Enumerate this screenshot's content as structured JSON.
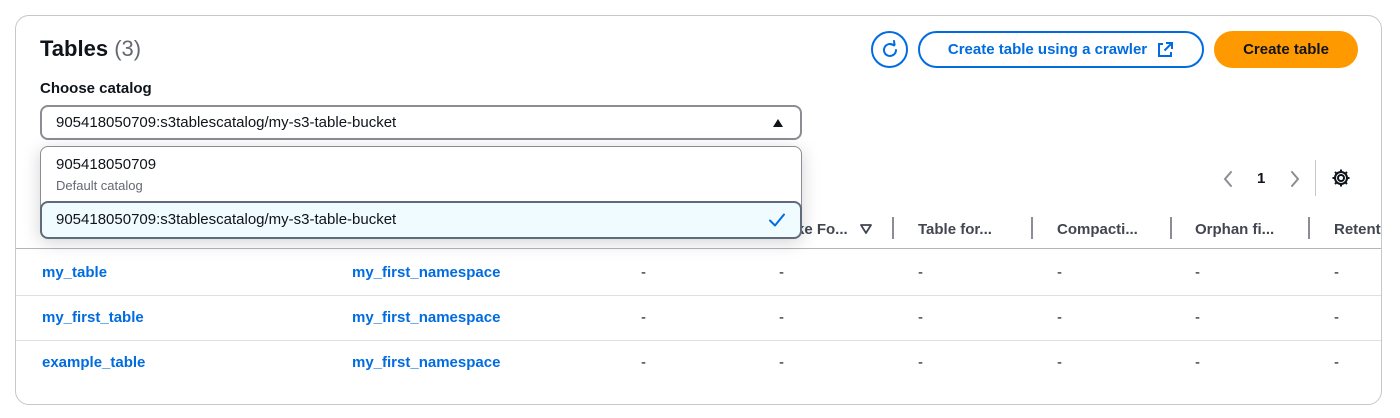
{
  "header": {
    "title": "Tables",
    "count": "(3)",
    "crawler_button_label": "Create table using a crawler",
    "create_button_label": "Create table"
  },
  "catalog": {
    "label": "Choose catalog",
    "selected": "905418050709:s3tablescatalog/my-s3-table-bucket",
    "options": [
      {
        "label": "905418050709",
        "description": "Default catalog"
      },
      {
        "label": "905418050709:s3tablescatalog/my-s3-table-bucket",
        "description": ""
      }
    ]
  },
  "pagination": {
    "current_page": "1"
  },
  "table": {
    "columns": [
      "ke Fo...",
      "Table for...",
      "Compacti...",
      "Orphan fi...",
      "Retent"
    ],
    "rows": [
      {
        "name": "my_table",
        "database": "my_first_namespace",
        "c1": "-",
        "c2": "-",
        "c3": "-",
        "c4": "-",
        "c5": "-",
        "c6": "-"
      },
      {
        "name": "my_first_table",
        "database": "my_first_namespace",
        "c1": "-",
        "c2": "-",
        "c3": "-",
        "c4": "-",
        "c5": "-",
        "c6": "-"
      },
      {
        "name": "example_table",
        "database": "my_first_namespace",
        "c1": "-",
        "c2": "-",
        "c3": "-",
        "c4": "-",
        "c5": "-",
        "c6": "-"
      }
    ]
  },
  "icons": {
    "refresh": "refresh-icon",
    "external_link": "external-link-icon",
    "caret": "caret-up-icon",
    "check": "check-icon",
    "settings": "gear-icon",
    "sort": "sort-down-icon"
  },
  "colors": {
    "primary": "#006ce0",
    "accent": "#ff9900",
    "selected_option_bg": "#f0fbff"
  }
}
